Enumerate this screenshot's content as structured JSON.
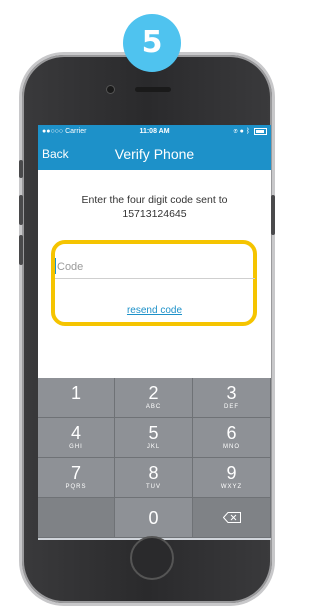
{
  "step": {
    "number": "5"
  },
  "status_bar": {
    "carrier": "●●○○○ Carrier",
    "time": "11:08 AM"
  },
  "nav": {
    "back_label": "Back",
    "title": "Verify Phone"
  },
  "prompt": {
    "line1": "Enter the four digit code sent to",
    "phone_number": "15713124645"
  },
  "code_input": {
    "placeholder": "Code",
    "value": ""
  },
  "resend_label": "resend code",
  "keypad": {
    "keys": [
      {
        "num": "1",
        "letters": ""
      },
      {
        "num": "2",
        "letters": "ABC"
      },
      {
        "num": "3",
        "letters": "DEF"
      },
      {
        "num": "4",
        "letters": "GHI"
      },
      {
        "num": "5",
        "letters": "JKL"
      },
      {
        "num": "6",
        "letters": "MNO"
      },
      {
        "num": "7",
        "letters": "PQRS"
      },
      {
        "num": "8",
        "letters": "TUV"
      },
      {
        "num": "9",
        "letters": "WXYZ"
      },
      {
        "num": "",
        "letters": ""
      },
      {
        "num": "0",
        "letters": ""
      },
      {
        "num": "",
        "letters": "",
        "icon": "backspace-icon"
      }
    ]
  },
  "colors": {
    "accent": "#1d91c9",
    "highlight": "#f5c400",
    "step_badge": "#4fc3ef"
  }
}
